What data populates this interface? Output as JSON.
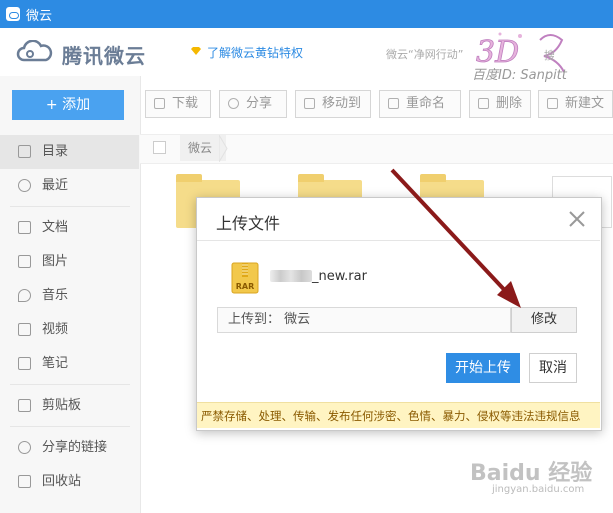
{
  "window": {
    "title": "微云"
  },
  "header": {
    "logo_text": "腾讯微云",
    "vip_link": "了解微云黄钻特权",
    "right_text": "微云“净网行动”",
    "watermark_id": "百度ID: Sanpitt",
    "watermark_logo": "3D",
    "watermark_suffix": "搜"
  },
  "sidebar": {
    "add_label": "+ 添加",
    "items": [
      {
        "label": "目录",
        "icon": "catalog-icon"
      },
      {
        "label": "最近",
        "icon": "clock-icon"
      },
      {
        "label": "文档",
        "icon": "document-icon"
      },
      {
        "label": "图片",
        "icon": "image-icon"
      },
      {
        "label": "音乐",
        "icon": "music-icon"
      },
      {
        "label": "视频",
        "icon": "video-icon"
      },
      {
        "label": "笔记",
        "icon": "note-icon"
      },
      {
        "label": "剪贴板",
        "icon": "clipboard-icon"
      },
      {
        "label": "分享的链接",
        "icon": "link-icon"
      },
      {
        "label": "回收站",
        "icon": "trash-icon"
      }
    ]
  },
  "toolbar": {
    "download": "下载",
    "share": "分享",
    "move_to": "移动到",
    "rename": "重命名",
    "delete": "删除",
    "new_folder": "新建文"
  },
  "breadcrumb": {
    "root": "微云"
  },
  "dialog": {
    "title": "上传文件",
    "file_name": "_new.rar",
    "file_type": "RAR",
    "upload_to": "上传到： 微云",
    "modify": "修改",
    "start_upload": "开始上传",
    "cancel": "取消",
    "warning": "严禁存储、处理、传输、发布任何涉密、色情、暴力、侵权等违法违规信息"
  },
  "watermark_bottom": {
    "brand": "Baidu 经验",
    "url": "jingyan.baidu.com"
  },
  "colors": {
    "titlebar": "#2d8be3",
    "accent": "#2f8de4",
    "arrow": "#8b1a1a",
    "warning_bg": "#fff4c2"
  }
}
